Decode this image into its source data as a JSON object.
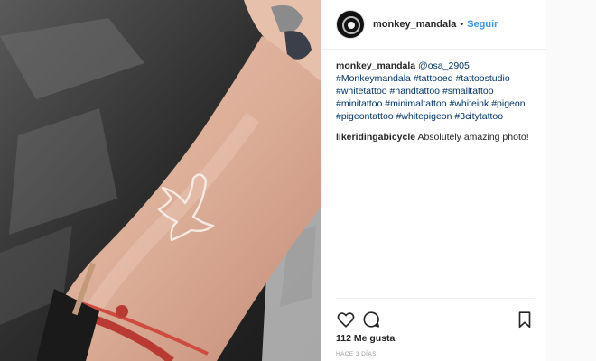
{
  "post": {
    "username": "monkey_mandala",
    "separator": "•",
    "follow_label": "Seguir",
    "avatar_text": "MONKEY MANDALA"
  },
  "caption": {
    "username": "monkey_mandala",
    "mention": "@osa_2905",
    "tags": [
      "#Monkeymandala",
      "#tattooed",
      "#tattoostudio",
      "#whitetattoo",
      "#handtattoo",
      "#smalltattoo",
      "#minitattoo",
      "#minimaltattoo",
      "#whiteink",
      "#pigeon",
      "#pigeontattoo",
      "#whitepigeon",
      "#3citytattoo"
    ]
  },
  "comment": {
    "username": "likeridingabicycle",
    "text": "Absolutely amazing photo!"
  },
  "actions": {
    "like_icon": "heart-outline-icon",
    "comment_icon": "speech-bubble-icon",
    "save_icon": "bookmark-icon"
  },
  "likes_text": "112 Me gusta",
  "timestamp": "HACE 3 DÍAS",
  "colors": {
    "link": "#003569",
    "follow": "#3897f0",
    "text": "#262626",
    "muted": "#999999"
  }
}
